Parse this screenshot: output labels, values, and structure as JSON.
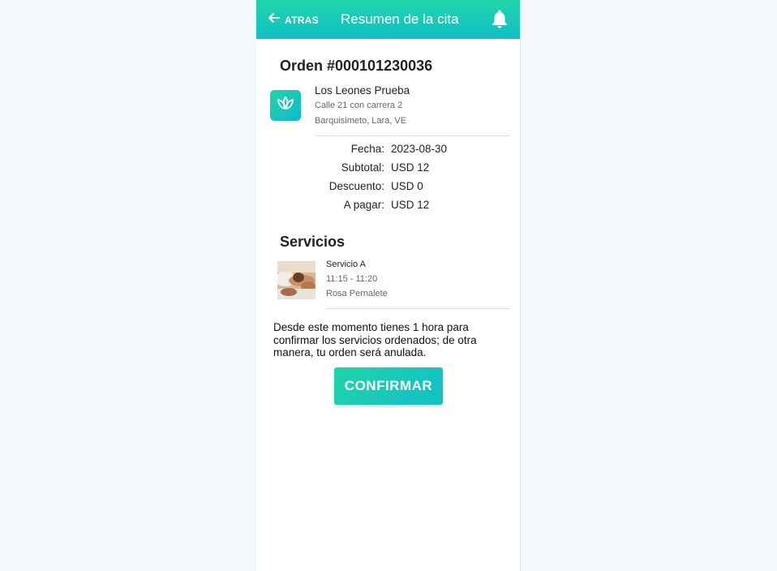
{
  "header": {
    "back_label": "ATRAS",
    "title": "Resumen de la cita",
    "back_icon": "arrow-left-icon",
    "bell_icon": "bell-icon"
  },
  "order": {
    "title": "Orden #000101230036"
  },
  "store": {
    "name": "Los Leones Prueba",
    "address": "Calle 21 con carrera 2",
    "city": "Barquisimeto, Lara, VE",
    "logo_icon": "lotus-icon"
  },
  "summary": [
    {
      "label": "Fecha:",
      "value": "2023-08-30"
    },
    {
      "label": "Subtotal:",
      "value": "USD 12"
    },
    {
      "label": "Descuento:",
      "value": "USD 0"
    },
    {
      "label": "A pagar:",
      "value": "USD 12"
    }
  ],
  "services": {
    "title": "Servicios",
    "items": [
      {
        "name": "Servicio A",
        "time": "11:15 - 11:20",
        "staff": "Rosa Pernalete"
      }
    ]
  },
  "notice": "Desde este momento tienes 1 hora para confirmar los servicios ordenados; de otra manera, tu orden será anulada.",
  "confirm_label": "CONFIRMAR",
  "colors": {
    "accent_start": "#20d4a8",
    "accent_end": "#12bfc8",
    "page_bg": "#f4f7fc"
  }
}
